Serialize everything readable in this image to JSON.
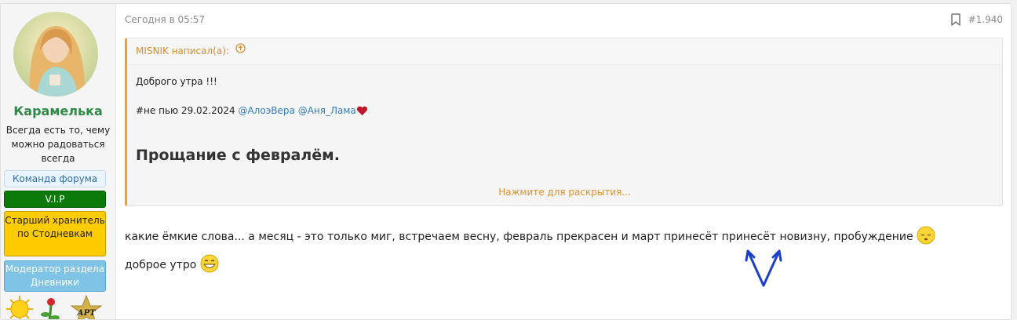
{
  "user": {
    "name": "Карамелька",
    "title": "Всегда есть то, чему можно радоваться всегда",
    "banners": {
      "team": "Команда форума",
      "vip": "V.I.P",
      "keeper": "Старший хранитель по Стодневкам",
      "moderator": "Модератор раздела Дневники"
    },
    "trophies": [
      "sun-trophy-icon",
      "flower-trophy-icon",
      "star-art-trophy-icon"
    ],
    "trophy_star_text": "АРТ"
  },
  "post": {
    "date": "Сегодня в 05:57",
    "number": "#1.940",
    "quote": {
      "author_line": "MISNIK написал(а):",
      "line1": "Доброго утра !!!",
      "line2_prefix": "#не пью 29.02.2024",
      "mention1": "@АлоэВера",
      "mention2": "@Аня_Лама",
      "heading": "Прощание с февралём.",
      "expand_label": "Нажмите для раскрытия..."
    },
    "body_line1": "какие ёмкие слова... а месяц - это только миг, встречаем весну, февраль прекрасен и март принесёт принесёт новизну, пробуждение",
    "body_line2": "доброе утро"
  },
  "colors": {
    "username": "#2e8b45",
    "quote_accent": "#f0a030",
    "mention": "#2f7bbf",
    "vip": "#0b7a0b",
    "keeper": "#ffcc00",
    "moderator": "#7fc3e6",
    "arrows": "#1a3fc9"
  }
}
